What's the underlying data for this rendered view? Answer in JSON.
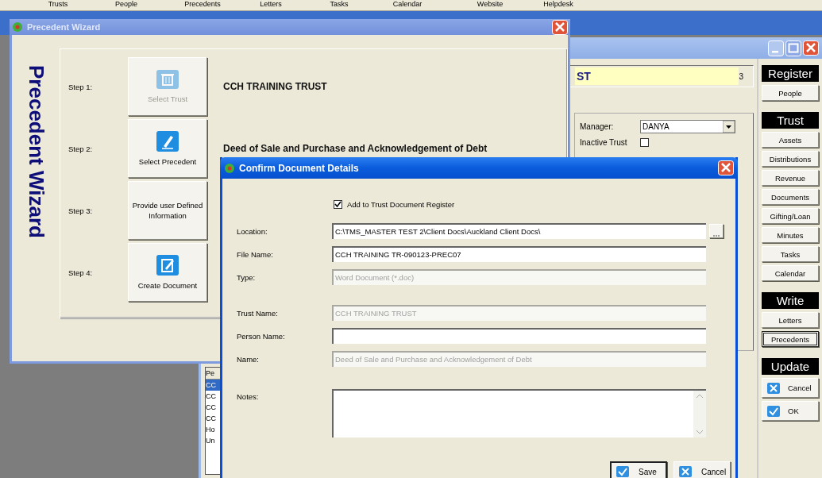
{
  "menu_bar": [
    "Trusts",
    "People",
    "Precedents",
    "Letters",
    "Tasks",
    "Calendar",
    "Website",
    "Helpdesk"
  ],
  "main_window": {
    "trust_field": "ST",
    "record_count": "3",
    "manager": {
      "label": "Manager:",
      "value": "DANYA"
    },
    "inactive_trust": {
      "label": "Inactive Trust",
      "checked": false
    },
    "side_panel": [
      {
        "heading": "Register",
        "buttons": [
          {
            "label": "People",
            "focused": false,
            "kind": "plain"
          }
        ]
      },
      {
        "heading": "Trust",
        "buttons": [
          {
            "label": "Assets",
            "focused": false,
            "kind": "plain"
          },
          {
            "label": "Distributions",
            "focused": false,
            "kind": "plain"
          },
          {
            "label": "Revenue",
            "focused": false,
            "kind": "plain"
          },
          {
            "label": "Documents",
            "focused": false,
            "kind": "plain"
          },
          {
            "label": "Gifting/Loan",
            "focused": false,
            "kind": "plain"
          },
          {
            "label": "Minutes",
            "focused": false,
            "kind": "plain"
          },
          {
            "label": "Tasks",
            "focused": false,
            "kind": "plain"
          },
          {
            "label": "Calendar",
            "focused": false,
            "kind": "plain"
          }
        ]
      },
      {
        "heading": "Write",
        "buttons": [
          {
            "label": "Letters",
            "focused": false,
            "kind": "plain"
          },
          {
            "label": "Precedents",
            "focused": true,
            "kind": "plain"
          }
        ]
      },
      {
        "heading": "Update",
        "buttons": [
          {
            "label": "Cancel",
            "focused": false,
            "kind": "cancel"
          },
          {
            "label": "OK",
            "focused": false,
            "kind": "ok"
          }
        ]
      }
    ],
    "list": {
      "header": "Pe",
      "rows": [
        {
          "text": "CC",
          "selected": true
        },
        {
          "text": "CC",
          "selected": false
        },
        {
          "text": "CC",
          "selected": false
        },
        {
          "text": "CC",
          "selected": false
        },
        {
          "text": "Ho",
          "selected": false
        },
        {
          "text": "Un",
          "selected": false
        }
      ]
    }
  },
  "precedent_wizard": {
    "title": "Precedent Wizard",
    "banner": "Precedent Wizard",
    "steps": [
      {
        "label": "Step 1:",
        "button": "Select Trust",
        "disabled": true,
        "kind": "bin",
        "result": "CCH TRAINING TRUST"
      },
      {
        "label": "Step 2:",
        "button": "Select Precedent",
        "disabled": false,
        "kind": "pen",
        "result": "Deed of Sale and Purchase and Acknowledgement of Debt"
      },
      {
        "label": "Step 3:",
        "button": "Provide user Defined Information",
        "disabled": false,
        "kind": "text"
      },
      {
        "label": "Step 4:",
        "button": "Create Document",
        "disabled": false,
        "kind": "edit"
      }
    ]
  },
  "confirm_dialog": {
    "title": "Confirm Document Details",
    "add_to_register": {
      "label": "Add to Trust Document Register",
      "checked": true
    },
    "field_groups": [
      [
        {
          "label": "Location:",
          "value": "C:\\TMS_MASTER TEST 2\\Client Docs\\Auckland Client Docs\\",
          "disabled": false,
          "browse": true
        },
        {
          "label": "File Name:",
          "value": "CCH TRAINING TR-090123-PREC07",
          "disabled": false
        },
        {
          "label": "Type:",
          "value": "Word Document (*.doc)",
          "disabled": true
        }
      ],
      [
        {
          "label": "Trust Name:",
          "value": "CCH TRAINING TRUST",
          "disabled": true
        },
        {
          "label": "Person Name:",
          "disabled": false
        },
        {
          "label": "Name:",
          "value": "Deed of Sale and Purchase and Acknowledgement of Debt",
          "disabled": true
        }
      ]
    ],
    "notes": {
      "label": "Notes:"
    },
    "buttons": [
      {
        "label": "Save",
        "kind": "save",
        "default": true
      },
      {
        "label": "Cancel",
        "kind": "cancel",
        "default": false
      }
    ]
  }
}
